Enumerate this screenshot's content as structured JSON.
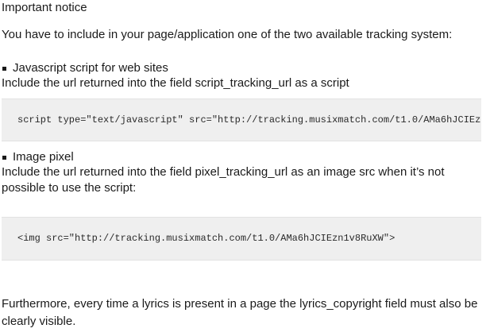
{
  "notice": {
    "title": "Important notice",
    "intro": "You have to include in your page/application one of the two available tracking system:"
  },
  "script_section": {
    "bullet": "Javascript script for web sites",
    "description": "Include the url returned into the field script_tracking_url as a script",
    "code": "script type=\"text/javascript\" src=\"http://tracking.musixmatch.com/t1.0/AMa6hJCIEz"
  },
  "pixel_section": {
    "bullet": "Image pixel",
    "description_line1": "Include the url returned into the field pixel_tracking_url as an image src when it’s not",
    "description_line2": "possible to use the script:",
    "code": "<img src=\"http://tracking.musixmatch.com/t1.0/AMa6hJCIEzn1v8RuXW\">"
  },
  "footer": {
    "paragraph": "Furthermore, every time a lyrics is present in a page the lyrics_copyright field must also be clearly visible."
  }
}
